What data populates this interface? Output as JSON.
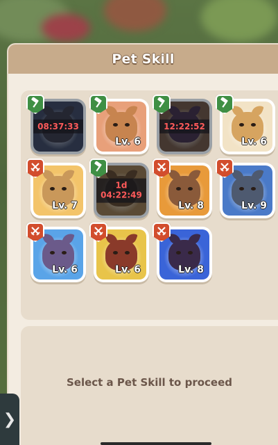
{
  "header": {
    "title": "Pet Skill"
  },
  "colors": {
    "panel_bg": "#f3ece1",
    "header_bg": "#c7ab8b",
    "grid_bg": "#e7dccc",
    "hammer_badge": "#3f8f44",
    "swords_badge": "#d24d2d",
    "timer_text": "#ff5a5a"
  },
  "pets": [
    {
      "badge": "hammer-icon",
      "level": "",
      "timer": "08:37:33",
      "locked": true,
      "bg": "#3a4d7a",
      "body": "#3a3f5c"
    },
    {
      "badge": "hammer-icon",
      "level": "Lv. 6",
      "timer": "",
      "locked": false,
      "bg": "#e8a07a",
      "body": "#c7844f"
    },
    {
      "badge": "hammer-icon",
      "level": "",
      "timer": "12:22:52",
      "locked": true,
      "bg": "#7a5a48",
      "body": "#4b3560"
    },
    {
      "badge": "hammer-icon",
      "level": "Lv. 6",
      "timer": "",
      "locked": false,
      "bg": "#f2e3c6",
      "body": "#d6a460"
    },
    {
      "badge": "swords-icon",
      "level": "Lv. 7",
      "timer": "",
      "locked": false,
      "bg": "#f3c46a",
      "body": "#c9985a"
    },
    {
      "badge": "hammer-icon",
      "level": "",
      "timer": "1d\n04:22:49",
      "locked": true,
      "bg": "#a27a44",
      "body": "#6a4a2a"
    },
    {
      "badge": "swords-icon",
      "level": "Lv. 8",
      "timer": "",
      "locked": false,
      "bg": "#e89a3a",
      "body": "#8a5a3a"
    },
    {
      "badge": "swords-icon",
      "level": "Lv. 9",
      "timer": "",
      "locked": false,
      "bg": "#4a7ac8",
      "body": "#4e5a70"
    },
    {
      "badge": "swords-icon",
      "level": "Lv. 6",
      "timer": "",
      "locked": false,
      "bg": "#5aa4e8",
      "body": "#6b5a8a"
    },
    {
      "badge": "swords-icon",
      "level": "Lv. 6",
      "timer": "",
      "locked": false,
      "bg": "#e8c44a",
      "body": "#8a3a2a"
    },
    {
      "badge": "swords-icon",
      "level": "Lv. 8",
      "timer": "",
      "locked": false,
      "bg": "#3a64d8",
      "body": "#3a2a4a"
    }
  ],
  "info": {
    "prompt": "Select a Pet Skill to proceed"
  },
  "side_tab": {
    "glyph": "❯"
  }
}
